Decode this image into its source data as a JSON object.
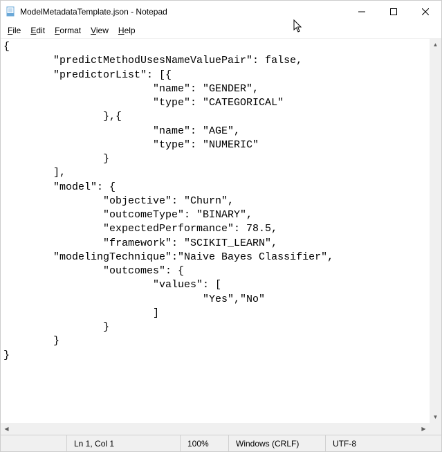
{
  "titlebar": {
    "title": "ModelMetadataTemplate.json - Notepad"
  },
  "menu": {
    "file": "File",
    "edit": "Edit",
    "format": "Format",
    "view": "View",
    "help": "Help"
  },
  "editor": {
    "content": "{\n        \"predictMethodUsesNameValuePair\": false,\n        \"predictorList\": [{\n                        \"name\": \"GENDER\",\n                        \"type\": \"CATEGORICAL\"\n                },{\n                        \"name\": \"AGE\",\n                        \"type\": \"NUMERIC\"\n                }\n        ],\n        \"model\": {\n                \"objective\": \"Churn\",\n                \"outcomeType\": \"BINARY\",\n                \"expectedPerformance\": 78.5,\n                \"framework\": \"SCIKIT_LEARN\",\n        \"modelingTechnique\":\"Naive Bayes Classifier\",\n                \"outcomes\": {\n                        \"values\": [\n                                \"Yes\",\"No\"\n                        ]\n                }\n        }\n}"
  },
  "status": {
    "position": "Ln 1, Col 1",
    "zoom": "100%",
    "newline": "Windows (CRLF)",
    "encoding": "UTF-8"
  }
}
